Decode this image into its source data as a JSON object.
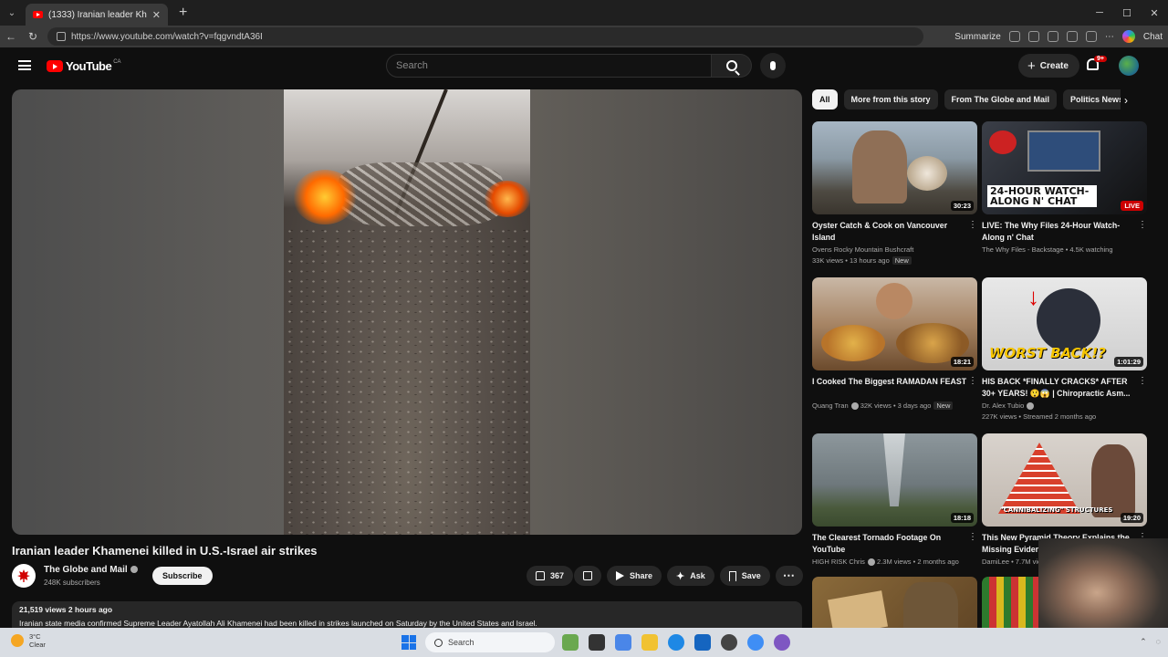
{
  "browser": {
    "tab_title": "(1333) Iranian leader Khamenei ki",
    "url": "https://www.youtube.com/watch?v=fqgvndtA36I",
    "summarize_label": "Summarize",
    "chat_label": "Chat",
    "new_tab": "+",
    "tab_close": "✕",
    "minimize": "─",
    "maximize": "☐",
    "close": "✕"
  },
  "header": {
    "logo_text": "YouTube",
    "country": "CA",
    "search_placeholder": "Search",
    "create_label": "Create",
    "notif_count": "9+"
  },
  "video": {
    "title": "Iranian leader Khamenei killed in U.S.-Israel air strikes",
    "channel": "The Globe and Mail",
    "subscribers": "248K subscribers",
    "subscribe_label": "Subscribe",
    "likes": "367",
    "share_label": "Share",
    "ask_label": "Ask",
    "save_label": "Save",
    "views_time": "21,519 views  2 hours ago",
    "description": "Iranian state media confirmed Supreme Leader Ayatollah Ali Khamenei had been killed in strikes launched on Saturday by the United States and Israel."
  },
  "chips": [
    "All",
    "More from this story",
    "From The Globe and Mail",
    "Politics News"
  ],
  "recommendations": [
    {
      "title": "Oyster Catch & Cook on Vancouver Island",
      "channel": "Ovens Rocky Mountain Bushcraft",
      "meta": "33K views • 13 hours ago",
      "badge": "New",
      "duration": "30:23",
      "thumb_color": "#7c8a95"
    },
    {
      "title": "LIVE: The Why Files 24-Hour Watch-Along n' Chat",
      "channel": "The Why Files - Backstage • 4.5K watching",
      "meta": "",
      "badge": "",
      "duration": "LIVE",
      "thumb_text": "24-HOUR WATCH-ALONG N' CHAT",
      "thumb_color": "#2c2f36"
    },
    {
      "title": "I Cooked The Biggest RAMADAN FEAST",
      "channel": "Quang Tran",
      "meta": "32K views • 3 days ago",
      "badge": "New",
      "duration": "18:21",
      "thumb_color": "#9a6a3a"
    },
    {
      "title": "HIS BACK *FINALLY CRACKS* AFTER 30+ YEARS! 😲😱 | Chiropractic Asm...",
      "channel": "Dr. Alex Tubio",
      "meta": "227K views • Streamed 2 months ago",
      "badge": "",
      "duration": "1:01:29",
      "thumb_text": "WORST BACK!?",
      "thumb_color": "#d8d8d8"
    },
    {
      "title": "The Clearest Tornado Footage On YouTube",
      "channel": "HIGH RISK Chris",
      "meta": "2.3M views • 2 months ago",
      "badge": "",
      "duration": "18:18",
      "thumb_color": "#7f8a8e"
    },
    {
      "title": "This New Pyramid Theory Explains the Missing Evidence",
      "channel": "DamiLee • 7.7M views",
      "meta": "",
      "badge": "",
      "duration": "19:20",
      "thumb_text": "\"CANNIBALIZING\" STRUCTURES",
      "thumb_color": "#c0492f"
    }
  ],
  "taskbar": {
    "temp": "3°C",
    "weather": "Clear",
    "search_label": "Search"
  }
}
